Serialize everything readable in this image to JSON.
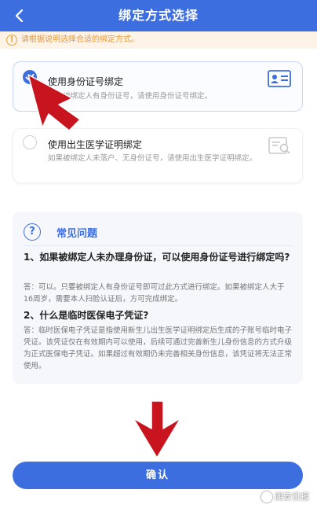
{
  "header": {
    "title": "绑定方式选择",
    "back_icon": "chevron-left-icon"
  },
  "notice": {
    "icon": "info-icon",
    "text": "请根据说明选择合适的绑定方式。"
  },
  "options": [
    {
      "title": "使用身份证号绑定",
      "desc": "如果被绑定人有身份证号，请使用身份证号绑定。",
      "selected": true,
      "icon": "id-card-icon"
    },
    {
      "title": "使用出生医学证明绑定",
      "desc": "如果被绑定人未落户、无身份证号，请使用出生医学证明绑定。",
      "selected": false,
      "icon": "birth-certificate-icon"
    }
  ],
  "faq": {
    "title": "常见问题",
    "icon": "question-icon",
    "items": [
      {
        "q": "1、如果被绑定人未办理身份证，可以使用身份证号进行绑定吗?",
        "a": "答：可以。只要被绑定人有身份证号即可过此方式进行绑定。如果被绑定人大于16周岁，需要本人扫脸认证后，方可完成绑定。"
      },
      {
        "q": "2、什么是临时医保电子凭证?",
        "a": "答：临时医保电子凭证是指使用新生儿出生医学证明绑定后生成的子账号临时电子凭证。该凭证仅在有效期内可以使用，后续可通过完善新生儿身份信息的方式升级为正式医保电子凭证。如果超过有效期仍未完善相关身份信息，该凭证将无法正常使用。"
      }
    ]
  },
  "confirm_label": "确认",
  "watermark": "西安日报",
  "colors": {
    "primary": "#3d6ee0",
    "notice_text": "#e69a3a",
    "annotation_arrow": "#c8141e"
  }
}
